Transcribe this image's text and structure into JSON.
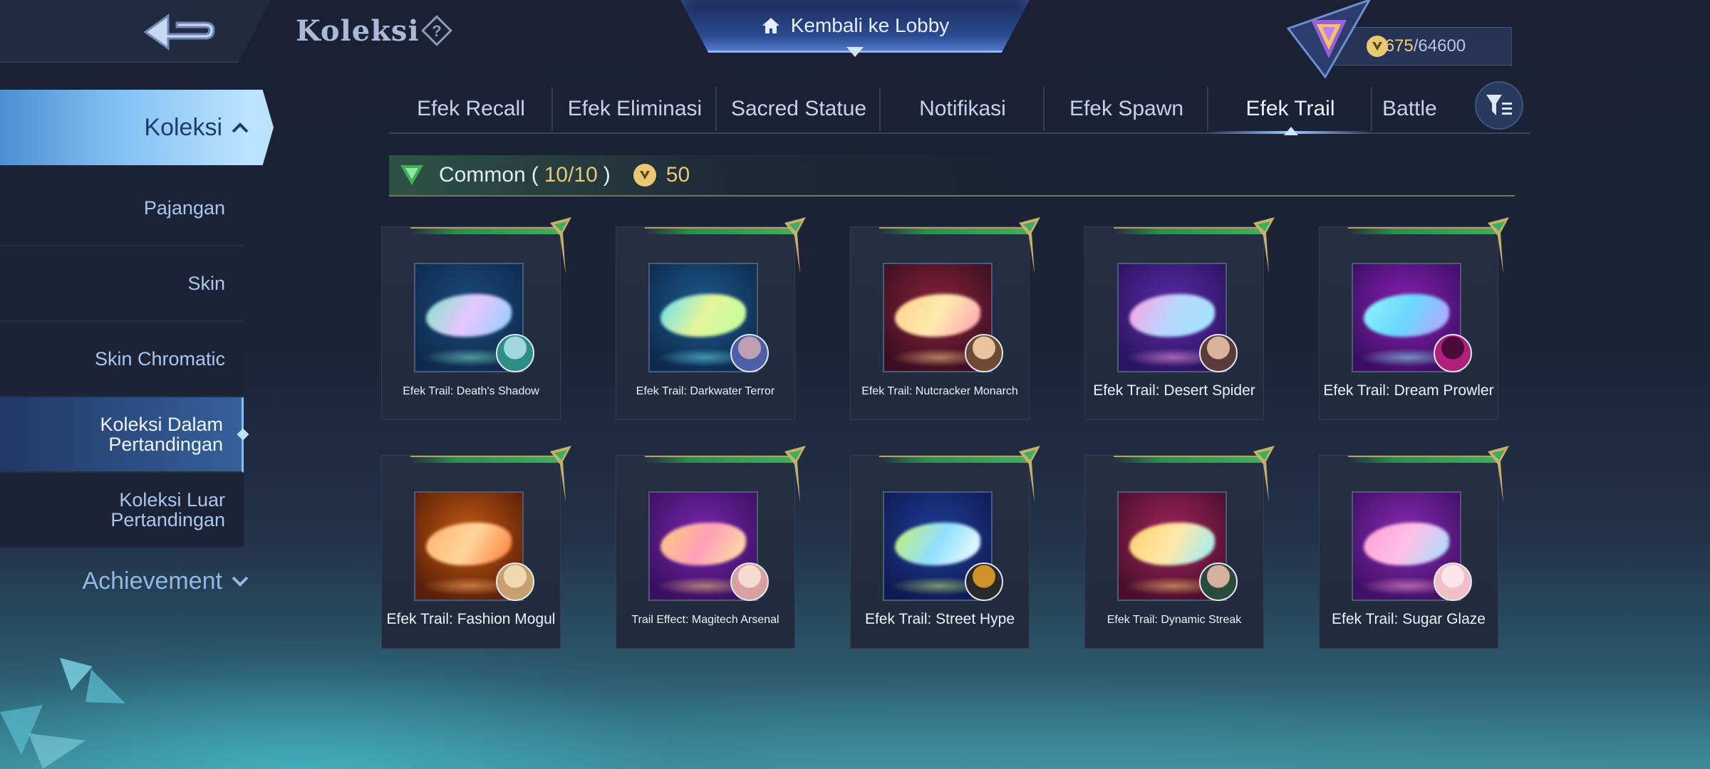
{
  "header": {
    "title": "Koleksi",
    "lobby_label": "Kembali ke Lobby",
    "points_current": "62675",
    "points_total": "/64600"
  },
  "sidebar": {
    "main_label": "Koleksi",
    "items": [
      {
        "label": "Pajangan",
        "active": false
      },
      {
        "label": "Skin",
        "active": false
      },
      {
        "label": "Skin Chromatic",
        "active": false
      },
      {
        "label": "Koleksi Dalam\nPertandingan",
        "active": true
      },
      {
        "label": "Koleksi Luar\nPertandingan",
        "active": false
      }
    ],
    "achievement_label": "Achievement"
  },
  "tabs": [
    {
      "label": "Efek Recall"
    },
    {
      "label": "Efek Eliminasi"
    },
    {
      "label": "Sacred Statue"
    },
    {
      "label": "Notifikasi"
    },
    {
      "label": "Efek Spawn"
    },
    {
      "label": "Efek Trail",
      "active": true
    },
    {
      "label": "Battle"
    }
  ],
  "section": {
    "rarity": "Common",
    "count_open": "(",
    "count": "10/10",
    "count_close": ")",
    "points": "50"
  },
  "cards": [
    {
      "name": "Efek Trail: Death's Shadow",
      "size": "small",
      "bg": [
        "#1a4a7a",
        "#0f2a4f"
      ],
      "trail": [
        "#7fe8c8",
        "#e6c6ff",
        "#8fd0ff"
      ],
      "avatar": [
        "#2e8d86",
        "#a0d6e0"
      ]
    },
    {
      "name": "Efek Trail: Darkwater Terror",
      "size": "small",
      "bg": [
        "#1d5a8f",
        "#0d2a4c"
      ],
      "trail": [
        "#64e0f0",
        "#e6f59a",
        "#b8ff9e"
      ],
      "avatar": [
        "#4c5fa8",
        "#c0a0b0"
      ]
    },
    {
      "name": "Efek Trail: Nutcracker Monarch",
      "size": "small",
      "bg": [
        "#8a2238",
        "#3a0f22"
      ],
      "trail": [
        "#ffd08a",
        "#ffeab0",
        "#ff9fb0"
      ],
      "avatar": [
        "#6e4a34",
        "#e8c4a0"
      ]
    },
    {
      "name": "Efek Trail: Desert Spider",
      "size": "large",
      "bg": [
        "#5c2aa8",
        "#2a1560"
      ],
      "trail": [
        "#ff9fe0",
        "#b8d8ff",
        "#9ee6ff"
      ],
      "avatar": [
        "#5a3a3a",
        "#d8b49a"
      ]
    },
    {
      "name": "Efek Trail: Dream Prowler",
      "size": "large",
      "bg": [
        "#8a1fb4",
        "#3b0f62"
      ],
      "trail": [
        "#8ff4ff",
        "#6ad8ff",
        "#c0a0ff"
      ],
      "avatar": [
        "#b01f7a",
        "#4a0a3a"
      ]
    },
    {
      "name": "Efek Trail: Fashion Mogul",
      "size": "large",
      "bg": [
        "#c45a12",
        "#5a1f08"
      ],
      "trail": [
        "#ffb26a",
        "#ffd59a",
        "#ff7a3a"
      ],
      "avatar": [
        "#c8a070",
        "#f0d8b0"
      ]
    },
    {
      "name": "Trail Effect: Magitech Arsenal",
      "size": "small",
      "bg": [
        "#7a25b0",
        "#3a1060"
      ],
      "trail": [
        "#ffce7a",
        "#ff9fb8",
        "#ffe6a0"
      ],
      "avatar": [
        "#d8a0a0",
        "#f5dcd0"
      ]
    },
    {
      "name": "Efek Trail: Street Hype",
      "size": "large",
      "bg": [
        "#1f3c9a",
        "#0f1c52"
      ],
      "trail": [
        "#c8f06a",
        "#8fe0ff",
        "#ffffff"
      ],
      "avatar": [
        "#2a2a2a",
        "#d0902a"
      ]
    },
    {
      "name": "Efek Trail: Dynamic Streak",
      "size": "small",
      "bg": [
        "#a0245a",
        "#4a0f2c"
      ],
      "trail": [
        "#ffd06a",
        "#ffe8a8",
        "#8ff0ff"
      ],
      "avatar": [
        "#2a4a3a",
        "#d8b0a0"
      ]
    },
    {
      "name": "Efek Trail: Sugar Glaze",
      "size": "large",
      "bg": [
        "#8a2ab4",
        "#3f1064"
      ],
      "trail": [
        "#ff9fd8",
        "#ffc0e8",
        "#a0e0ff"
      ],
      "avatar": [
        "#f0c0c8",
        "#fce4e8"
      ]
    }
  ],
  "icons": {
    "back": "back-arrow-icon",
    "help": "question-icon",
    "home": "home-icon",
    "filter": "filter-icon",
    "coin": "coin-icon",
    "rank": "rank-emblem-icon"
  }
}
